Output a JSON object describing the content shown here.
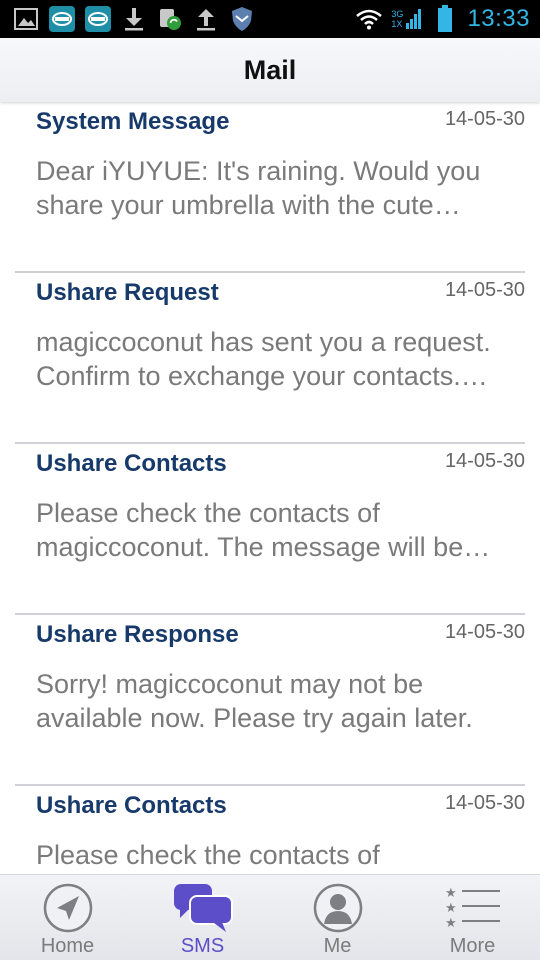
{
  "status_bar": {
    "time": "13:33",
    "network_top": "3G",
    "network_bottom": "1X",
    "icons": [
      "gallery-icon",
      "app-icon",
      "app-icon",
      "download-icon",
      "sync-icon",
      "upload-icon",
      "shield-icon",
      "wifi-icon",
      "signal-icon",
      "battery-icon"
    ],
    "accent_color": "#33b5e5"
  },
  "header": {
    "title": "Mail"
  },
  "messages": [
    {
      "title": "System Message",
      "date": "14-05-30",
      "preview": "Dear iYUYUE: It's raining. Would you share your umbrella with the cute…"
    },
    {
      "title": "Ushare Request",
      "date": "14-05-30",
      "preview": "magiccoconut has sent you a request. Confirm to exchange your contacts.…"
    },
    {
      "title": "Ushare Contacts",
      "date": "14-05-30",
      "preview": "Please check the contacts of magiccoconut. The message will be…"
    },
    {
      "title": "Ushare Response",
      "date": "14-05-30",
      "preview": "Sorry! magiccoconut may not be available now. Please try again later."
    },
    {
      "title": "Ushare Contacts",
      "date": "14-05-30",
      "preview": "Please check the contacts of"
    }
  ],
  "tabs": [
    {
      "label": "Home",
      "icon": "compass-icon",
      "active": false
    },
    {
      "label": "SMS",
      "icon": "chat-bubbles-icon",
      "active": true
    },
    {
      "label": "Me",
      "icon": "person-icon",
      "active": false
    },
    {
      "label": "More",
      "icon": "star-list-icon",
      "active": false
    }
  ],
  "colors": {
    "title_text": "#173a6b",
    "active_tab": "#5c4ec9",
    "preview_text": "#7a7a7a"
  }
}
